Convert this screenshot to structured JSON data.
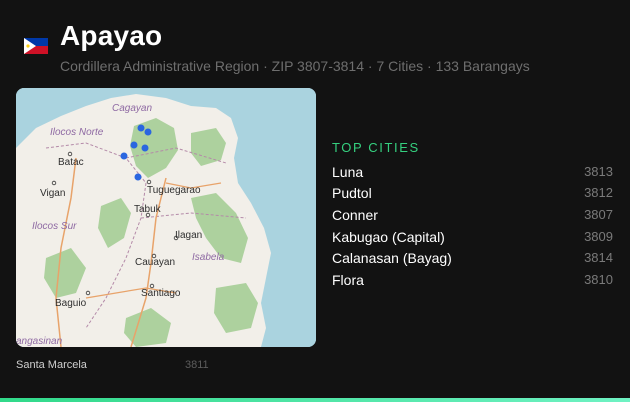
{
  "province": {
    "name": "Apayao",
    "subtitle": "Cordillera Administrative Region · ZIP 3807-3814 · 7 Cities · 133 Barangays"
  },
  "top_cities": {
    "title": "TOP CITIES",
    "items": [
      {
        "name": "Luna",
        "zip": "3813"
      },
      {
        "name": "Pudtol",
        "zip": "3812"
      },
      {
        "name": "Conner",
        "zip": "3807"
      },
      {
        "name": "Kabugao (Capital)",
        "zip": "3809"
      },
      {
        "name": "Calanasan (Bayag)",
        "zip": "3814"
      },
      {
        "name": "Flora",
        "zip": "3810"
      }
    ]
  },
  "extra_city": {
    "name": "Santa Marcela",
    "zip": "3811"
  },
  "map": {
    "labels": {
      "cagayan": "Cagayan",
      "ilocos_norte": "Ilocos Norte",
      "batac": "Batac",
      "vigan": "Vigan",
      "ilocos_sur": "Ilocos Sur",
      "tuguegarao": "Tuguegarao",
      "tabuk": "Tabuk",
      "ilagan": "Ilagan",
      "isabela": "Isabela",
      "cauayan": "Cauayan",
      "santiago": "Santiago",
      "baguio": "Baguio",
      "pangasinan": "angasinan"
    }
  },
  "colors": {
    "accent": "#35d07f",
    "background": "#121212",
    "water": "#aad3df",
    "land": "#f2efe9",
    "forest": "#add19e",
    "marker": "#2a66e0"
  },
  "icons": {
    "flag": "philippines-flag-icon"
  }
}
